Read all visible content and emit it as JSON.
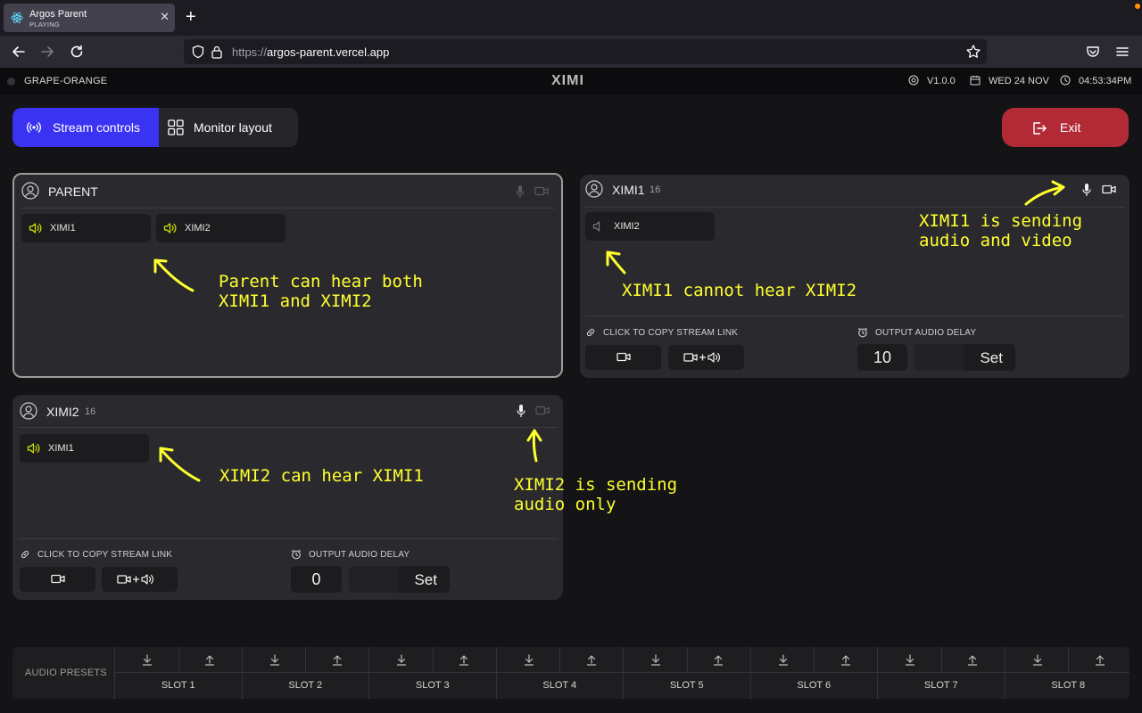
{
  "browser": {
    "tab_title": "Argos Parent",
    "tab_status": "PLAYING",
    "url_prefix": "https://",
    "url_host": "argos-parent.vercel.app"
  },
  "app_header": {
    "device_name": "GRAPE-ORANGE",
    "logo": "XIMI",
    "version": "V1.0.0",
    "date": "WED 24 NOV",
    "time": "04:53:34PM"
  },
  "controls": {
    "stream_controls_label": "Stream controls",
    "monitor_layout_label": "Monitor layout",
    "exit_label": "Exit"
  },
  "panels": {
    "parent": {
      "title": "PARENT",
      "hears": [
        "XIMI1",
        "XIMI2"
      ]
    },
    "ximi1": {
      "title": "XIMI1",
      "count": "16",
      "hears": [
        "XIMI2"
      ],
      "copy_link_label": "CLICK TO COPY STREAM LINK",
      "delay_label": "OUTPUT AUDIO DELAY",
      "delay_value": "10",
      "set_label": "Set"
    },
    "ximi2": {
      "title": "XIMI2",
      "count": "16",
      "hears": [
        "XIMI1"
      ],
      "copy_link_label": "CLICK TO COPY STREAM LINK",
      "delay_label": "OUTPUT AUDIO DELAY",
      "delay_value": "0",
      "set_label": "Set"
    }
  },
  "annotations": {
    "parent_hears": "Parent can hear both\nXIMI1 and XIMI2",
    "ximi1_sending": "XIMI1 is sending\naudio and video",
    "ximi1_cannot": "XIMI1 cannot hear XIMI2",
    "ximi2_hears": "XIMI2 can hear XIMI1",
    "ximi2_sending": "XIMI2 is sending\naudio only"
  },
  "presets": {
    "title": "AUDIO PRESETS",
    "slots": [
      "SLOT 1",
      "SLOT 2",
      "SLOT 3",
      "SLOT 4",
      "SLOT 5",
      "SLOT 6",
      "SLOT 7",
      "SLOT 8"
    ]
  },
  "colors": {
    "accent": "#3a33f2",
    "exit": "#b22a36",
    "active_speaker": "#d4e600",
    "annotation": "#ffff2e"
  }
}
